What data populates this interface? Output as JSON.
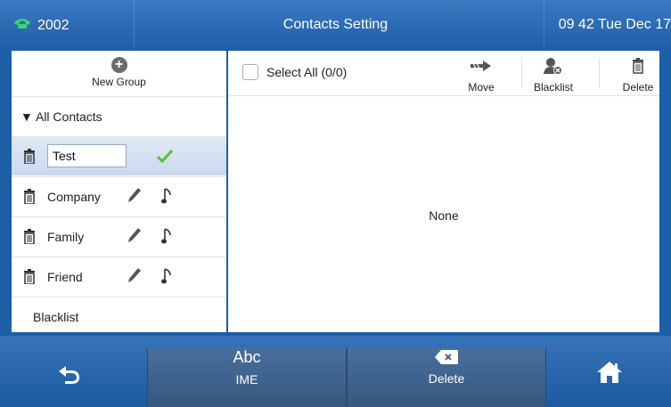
{
  "status_bar": {
    "extension": "2002",
    "title": "Contacts Setting",
    "clock": "09 42 Tue Dec 17"
  },
  "sidebar": {
    "new_group_label": "New Group",
    "all_contacts_label": "All Contacts",
    "editing_group": {
      "value": "Test"
    },
    "groups": [
      {
        "label": "Company"
      },
      {
        "label": "Family"
      },
      {
        "label": "Friend"
      }
    ],
    "blacklist_label": "Blacklist"
  },
  "toolbar": {
    "select_all_label": "Select All (0/0)",
    "move_label": "Move",
    "blacklist_label": "Blacklist",
    "delete_label": "Delete"
  },
  "content": {
    "empty_text": "None"
  },
  "softkeys": {
    "ime_top": "Abc",
    "ime_label": "IME",
    "delete_label": "Delete"
  },
  "colors": {
    "accent": "#1f5ea8",
    "check": "#5bbf2a"
  },
  "icons": [
    "phone-icon",
    "plus-circle-icon",
    "trash-icon",
    "pencil-icon",
    "music-note-icon",
    "checkmark-icon",
    "move-arrow-icon",
    "blacklist-user-icon",
    "backspace-icon",
    "back-arrow-icon",
    "home-icon"
  ]
}
